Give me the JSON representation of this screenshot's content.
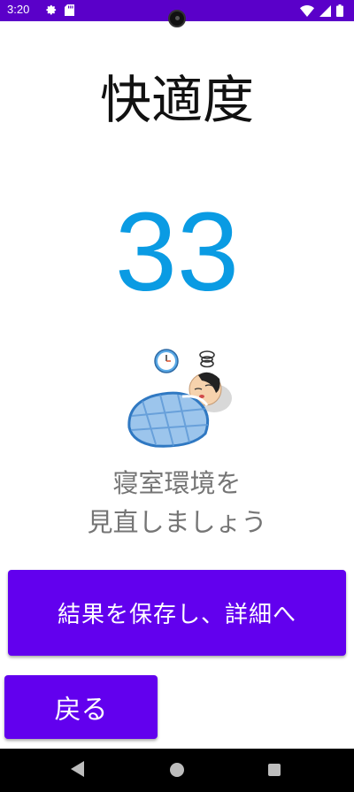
{
  "status_bar": {
    "time": "3:20",
    "left_icons": [
      "gear-icon",
      "sd-card-icon"
    ],
    "right_icons": [
      "wifi-icon",
      "signal-icon",
      "battery-icon"
    ],
    "color": "#5a00c9"
  },
  "main": {
    "title": "快適度",
    "score": "33",
    "score_color": "#0a9be3",
    "message_line1": "寝室環境を",
    "message_line2": "見直しましょう"
  },
  "buttons": {
    "save_label": "結果を保存し、詳細へ",
    "back_label": "戻る",
    "color": "#6200ee"
  },
  "nav_bar": {
    "items": [
      "back-icon",
      "home-icon",
      "recents-icon"
    ]
  }
}
